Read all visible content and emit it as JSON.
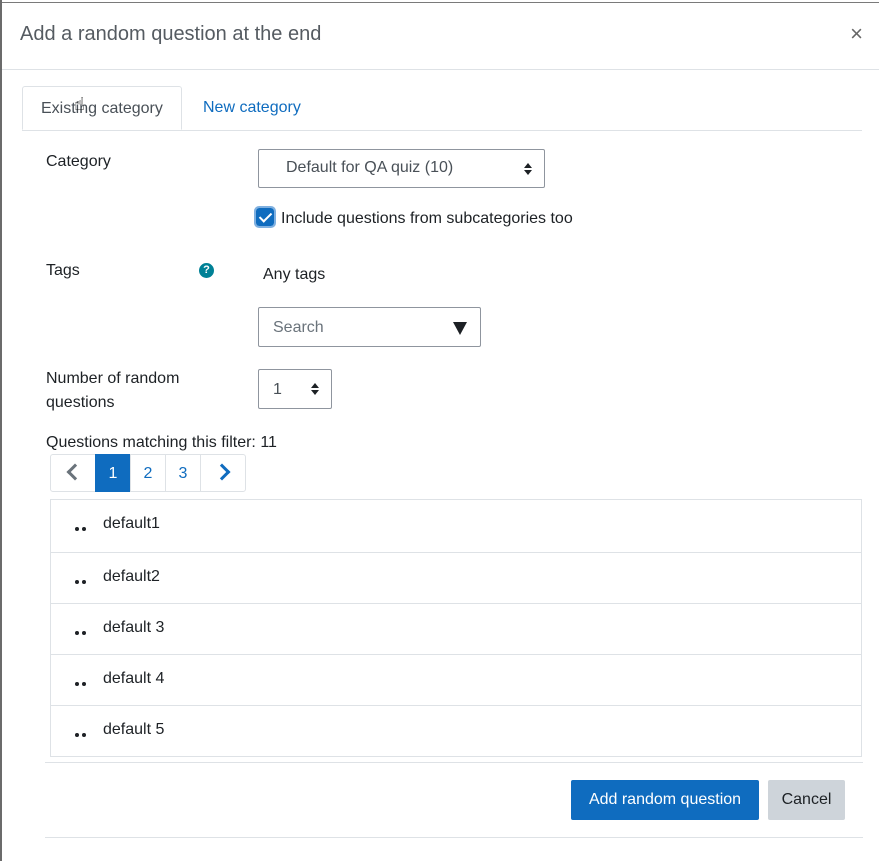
{
  "modal": {
    "title": "Add a random question at the end",
    "close_label": "×"
  },
  "tabs": [
    {
      "label": "Existing category",
      "active": true
    },
    {
      "label": "New category",
      "active": false
    }
  ],
  "form": {
    "category_label": "Category",
    "category_value": "Default for QA quiz (10)",
    "include_subcategories_label": "Include questions from subcategories too",
    "include_subcategories_checked": true,
    "tags_label": "Tags",
    "tags_value": "Any tags",
    "tags_search_placeholder": "Search",
    "number_label": "Number of random questions",
    "number_value": "1",
    "matching_text": "Questions matching this filter: 11"
  },
  "pagination": {
    "pages": [
      "1",
      "2",
      "3"
    ],
    "current": "1"
  },
  "questions": [
    "default1",
    "default2",
    "default 3",
    "default 4",
    "default 5"
  ],
  "buttons": {
    "add": "Add random question",
    "cancel": "Cancel"
  },
  "colors": {
    "primary": "#0f6cbf",
    "help_icon": "#008196",
    "secondary_button": "#ced4da"
  }
}
